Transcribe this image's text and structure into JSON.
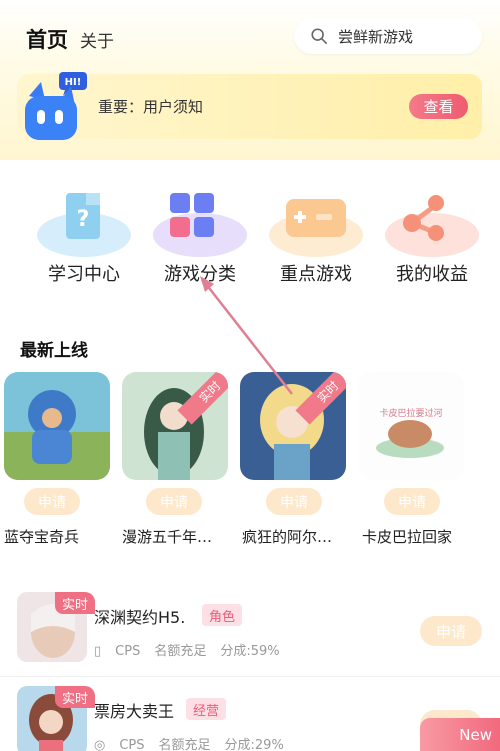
{
  "header": {
    "tab_home": "首页",
    "tab_about": "关于",
    "search_placeholder": "尝鲜新游戏"
  },
  "notice": {
    "text": "重要：用户须知",
    "button": "查看",
    "mascot_bubble": "HI!"
  },
  "categories": [
    {
      "label": "学习中心",
      "icon": "question-icon"
    },
    {
      "label": "游戏分类",
      "icon": "grid-icon"
    },
    {
      "label": "重点游戏",
      "icon": "gamepad-icon"
    },
    {
      "label": "我的收益",
      "icon": "share-icon"
    }
  ],
  "section": {
    "title": "最新上线"
  },
  "new_games": [
    {
      "name": "蓝夺宝奇兵",
      "button": "申请",
      "tag": ""
    },
    {
      "name": "漫游五千年…",
      "button": "申请",
      "tag": "实时"
    },
    {
      "name": "疯狂的阿尔…",
      "button": "申请",
      "tag": "实时"
    },
    {
      "name": "卡皮巴拉回家",
      "button": "申请",
      "tag": ""
    }
  ],
  "list": [
    {
      "tag": "实时",
      "name": "深渊契约H5.",
      "category": "角色",
      "type": "CPS",
      "quota": "名额充足",
      "share": "分成:59%",
      "button": "申请"
    },
    {
      "tag": "实时",
      "name": "票房大卖王",
      "category": "经营",
      "type": "CPS",
      "quota": "名额充足",
      "share": "分成:29%",
      "button": "申请"
    }
  ],
  "floating": {
    "new": "New"
  },
  "colors": {
    "accent": "#ef5b70",
    "apply_bg": "#fde8cb",
    "notice_bg": "#fff3c0"
  }
}
